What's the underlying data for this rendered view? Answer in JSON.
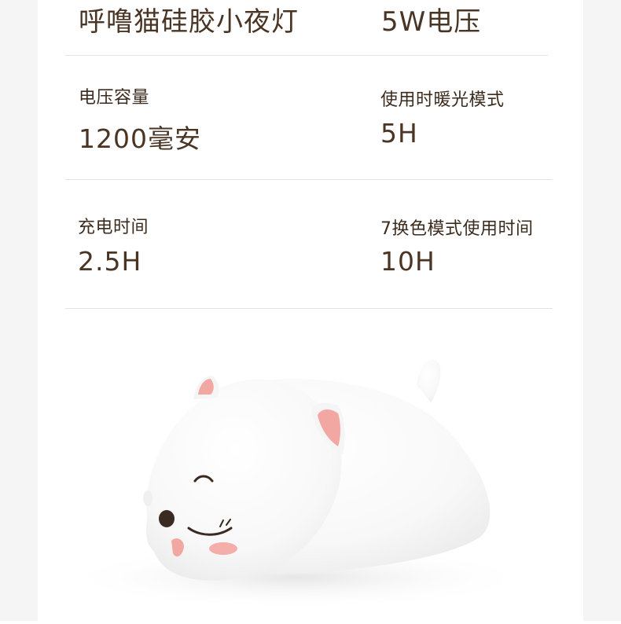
{
  "specs": {
    "row1": {
      "left_value": "呼噜猫硅胶小夜灯",
      "right_value": "5W电压"
    },
    "row2": {
      "left_label": "电压容量",
      "left_value": "1200毫安",
      "right_label": "使用时暖光模式",
      "right_value": "5H"
    },
    "row3": {
      "left_label": "充电时间",
      "left_value": "2.5H",
      "right_label": "7换色模式使用时间",
      "right_value": "10H"
    }
  },
  "colors": {
    "text": "#4a3424",
    "divider": "#e3e3e3",
    "cat_body": "#fbfbfb",
    "ear_inner": "#f2a7a3",
    "blush": "#f4a6a2"
  },
  "product": {
    "icon": "cat-night-light-image"
  }
}
